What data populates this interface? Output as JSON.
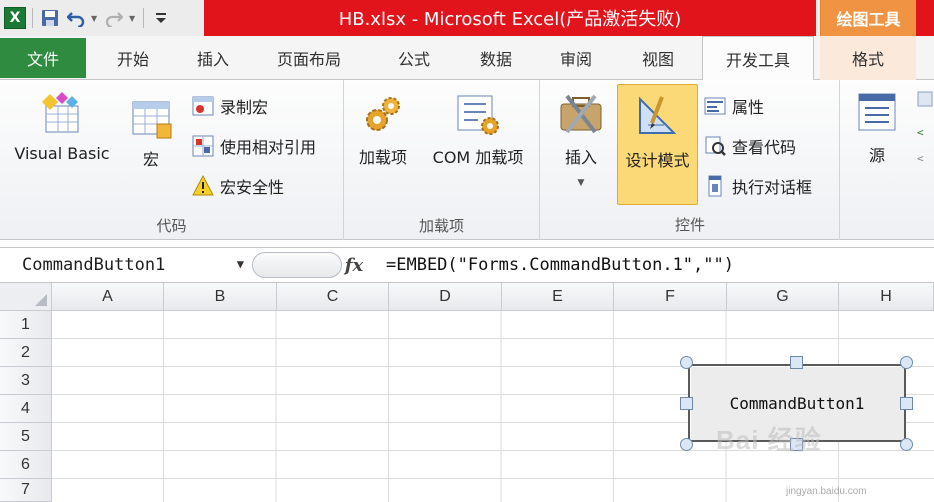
{
  "qat": {
    "app_icon": "excel-icon",
    "save_icon": "save-icon",
    "undo_icon": "undo-icon",
    "redo_icon": "redo-icon",
    "customize_icon": "customize-qat-icon"
  },
  "title": {
    "text": "HB.xlsx - Microsoft Excel(产品激活失败)",
    "contextual_header": "绘图工具"
  },
  "tabs": [
    {
      "label": "文件"
    },
    {
      "label": "开始"
    },
    {
      "label": "插入"
    },
    {
      "label": "页面布局"
    },
    {
      "label": "公式"
    },
    {
      "label": "数据"
    },
    {
      "label": "审阅"
    },
    {
      "label": "视图"
    },
    {
      "label": "开发工具"
    },
    {
      "label": "格式"
    }
  ],
  "ribbon": {
    "code": {
      "label": "代码",
      "visual_basic": "Visual Basic",
      "macros": "宏",
      "record_macro": "录制宏",
      "relative_ref": "使用相对引用",
      "macro_security": "宏安全性"
    },
    "addins": {
      "label": "加载项",
      "addins": "加载项",
      "com_addins": "COM 加载项"
    },
    "controls": {
      "label": "控件",
      "insert": "插入",
      "design_mode": "设计模式",
      "properties": "属性",
      "view_code": "查看代码",
      "run_dialog": "执行对话框"
    },
    "xml": {
      "source": "源"
    }
  },
  "formula_bar": {
    "name_box": "CommandButton1",
    "fx": "fx",
    "formula": "=EMBED(\"Forms.CommandButton.1\",\"\")"
  },
  "grid": {
    "columns": [
      "A",
      "B",
      "C",
      "D",
      "E",
      "F",
      "G",
      "H"
    ],
    "rows": [
      "1",
      "2",
      "3",
      "4",
      "5",
      "6",
      "7"
    ]
  },
  "command_button": {
    "caption": "CommandButton1"
  },
  "watermark": {
    "text": "Bai 经验",
    "url": "jingyan.baidu.com"
  }
}
